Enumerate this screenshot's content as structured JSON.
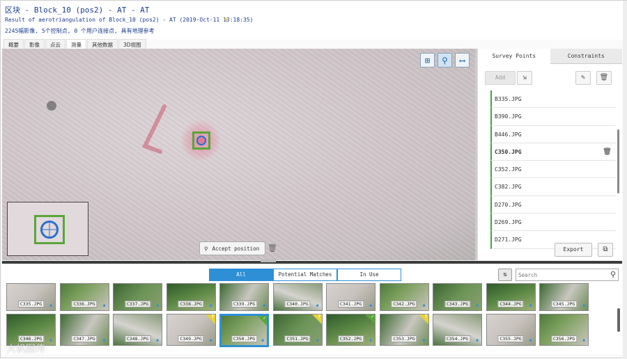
{
  "header": {
    "title": "区块 - Block_10 (pos2) - AT - AT",
    "subtitle": "Result of aerotriangulation of Block_10 (pos2) - AT (2019-Oct-11 13:18:35)",
    "stats": "2245幅影像, 5个控制点, 0 个用户连接点, 具有地理参考"
  },
  "tabs": [
    "概要",
    "影像",
    "点云",
    "测量",
    "其他数据",
    "3D视图"
  ],
  "active_tab": "测量",
  "viewer": {
    "accept_label": "Accept position"
  },
  "right_panel": {
    "tabs": [
      "Survey Points",
      "Constraints"
    ],
    "add_label": "Add",
    "points": [
      {
        "name": "B335.JPG",
        "selected": false
      },
      {
        "name": "B390.JPG",
        "selected": false
      },
      {
        "name": "B446.JPG",
        "selected": false
      },
      {
        "name": "C350.JPG",
        "selected": true
      },
      {
        "name": "C352.JPG",
        "selected": false
      },
      {
        "name": "C382.JPG",
        "selected": false
      },
      {
        "name": "D270.JPG",
        "selected": false
      },
      {
        "name": "D269.JPG",
        "selected": false
      },
      {
        "name": "D271.JPG",
        "selected": false
      }
    ],
    "export_label": "Export"
  },
  "bottom": {
    "filters": [
      "All",
      "Potential Matches",
      "In Use"
    ],
    "active_filter": "All",
    "search_placeholder": "Search",
    "row1": [
      "C335.JPG",
      "C336.JPG",
      "C337.JPG",
      "C338.JPG",
      "C339.JPG",
      "C340.JPG",
      "C341.JPG",
      "C342.JPG",
      "C343.JPG",
      "C344.JPG",
      "C345.JPG"
    ],
    "row2": [
      {
        "name": "C346.JPG",
        "flag": "",
        "selected": false
      },
      {
        "name": "C347.JPG",
        "flag": "",
        "selected": false
      },
      {
        "name": "C348.JPG",
        "flag": "",
        "selected": false
      },
      {
        "name": "C349.JPG",
        "flag": "?",
        "selected": false
      },
      {
        "name": "C350.JPG",
        "flag": "✓",
        "selected": true
      },
      {
        "name": "C351.JPG",
        "flag": "?",
        "selected": false
      },
      {
        "name": "C352.JPG",
        "flag": "✓",
        "selected": false
      },
      {
        "name": "C353.JPG",
        "flag": "?",
        "selected": false
      },
      {
        "name": "C354.JPG",
        "flag": "",
        "selected": false
      },
      {
        "name": "C355.JPG",
        "flag": "",
        "selected": false
      },
      {
        "name": "C356.JPG",
        "flag": "",
        "selected": false
      }
    ]
  },
  "watermark": "大帆图传",
  "colors": {
    "accent": "#2e8fd6",
    "point_marker": "#5aa53a",
    "flag_pending": "#e8d23a",
    "flag_ok": "#5aa53a"
  }
}
